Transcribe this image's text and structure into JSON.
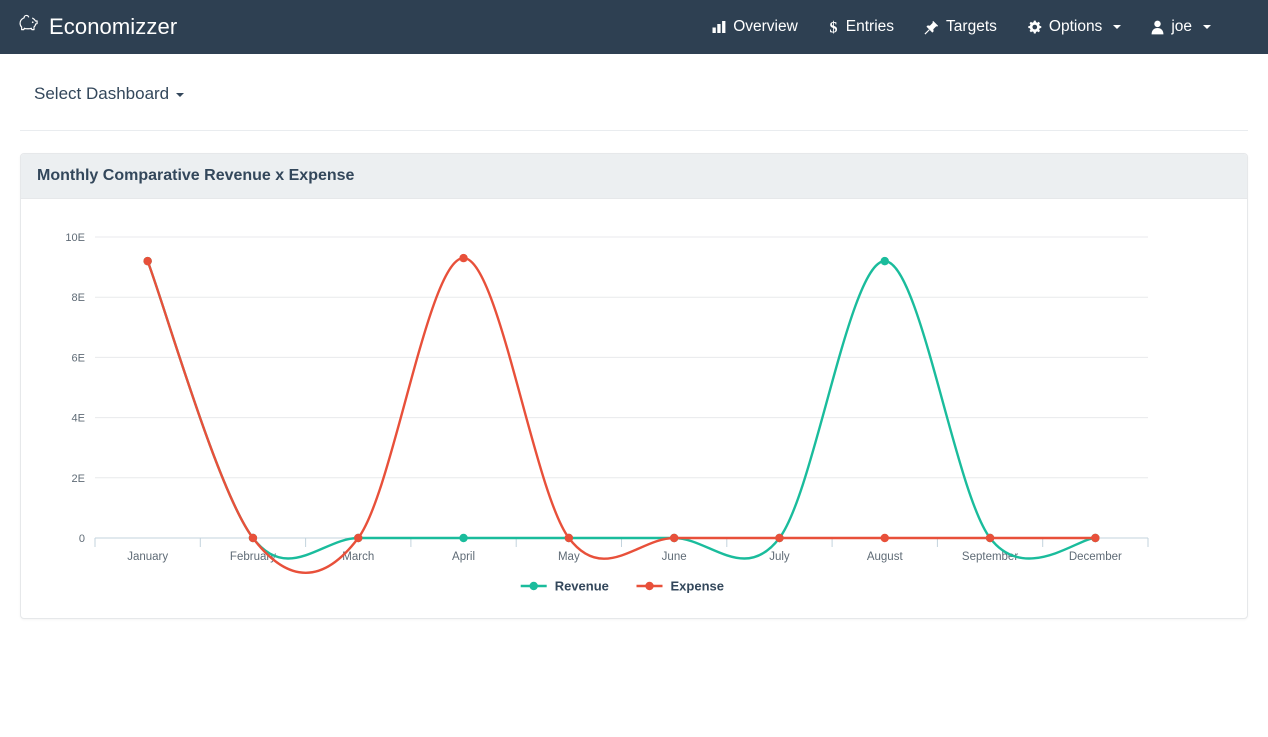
{
  "brand": {
    "label": "Economizzer",
    "icon": "piggy-bank-icon"
  },
  "nav": {
    "items": [
      {
        "label": "Overview",
        "icon": "bar-chart-icon",
        "caret": false
      },
      {
        "label": "Entries",
        "icon": "dollar-sign-icon",
        "caret": false
      },
      {
        "label": "Targets",
        "icon": "pushpin-icon",
        "caret": false
      },
      {
        "label": "Options",
        "icon": "gear-icon",
        "caret": true
      },
      {
        "label": "joe",
        "icon": "user-icon",
        "caret": true
      }
    ]
  },
  "dashboard_selector": {
    "label": "Select Dashboard"
  },
  "panel": {
    "title": "Monthly Comparative Revenue x Expense"
  },
  "chart_data": {
    "type": "line",
    "title": "Monthly Comparative Revenue x Expense",
    "xlabel": "",
    "ylabel": "",
    "categories": [
      "January",
      "February",
      "March",
      "April",
      "May",
      "June",
      "July",
      "August",
      "September",
      "December"
    ],
    "ytick_labels": [
      "10E",
      "8E",
      "6E",
      "4E",
      "2E",
      "0"
    ],
    "ytick_values": [
      10,
      8,
      6,
      4,
      2,
      0
    ],
    "ylim": [
      0,
      10.4
    ],
    "grid": true,
    "legend_position": "bottom",
    "interpolation": "smooth",
    "series": [
      {
        "name": "Revenue",
        "color": "#1abc9c",
        "values": [
          9.2,
          0,
          0,
          0,
          0,
          0,
          0,
          9.2,
          0,
          0
        ]
      },
      {
        "name": "Expense",
        "color": "#e8503a",
        "values": [
          9.2,
          0,
          0,
          9.3,
          0,
          0,
          0,
          0,
          0,
          0
        ]
      }
    ]
  },
  "colors": {
    "navbar": "#2e4052",
    "panel_header": "#eceff1",
    "revenue": "#1abc9c",
    "expense": "#e8503a",
    "text_dark": "#33475b",
    "grid": "#e8eaec",
    "axis": "#c3d3dd"
  }
}
